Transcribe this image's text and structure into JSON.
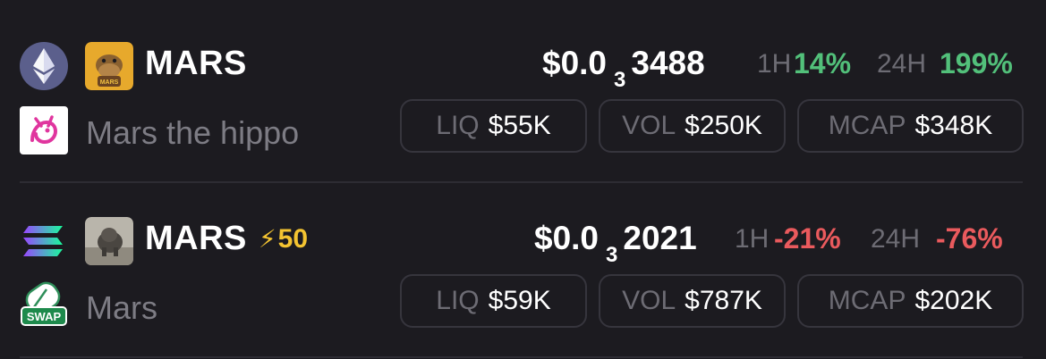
{
  "rows": [
    {
      "chain_icon": "ethereum-icon",
      "dex_icon": "uniswap-icon",
      "token_icon": "hippo-cartoon-icon",
      "symbol": "MARS",
      "boost": "",
      "name": "Mars the hippo",
      "price_prefix": "$0.0",
      "price_zeros": "3",
      "price_digits": "3488",
      "h1_label": "1H",
      "h1_value": "14%",
      "h24_label": "24H",
      "h24_value": "199%",
      "liq_label": "LIQ",
      "liq_value": "$55K",
      "vol_label": "VOL",
      "vol_value": "$250K",
      "mcap_label": "MCAP",
      "mcap_value": "$348K",
      "colors": {
        "change": "#52c07a"
      }
    },
    {
      "chain_icon": "solana-icon",
      "dex_icon": "swap-pill-icon",
      "token_icon": "hippo-photo-icon",
      "symbol": "MARS",
      "boost": "50",
      "name": "Mars",
      "price_prefix": "$0.0",
      "price_zeros": "3",
      "price_digits": "2021",
      "h1_label": "1H",
      "h1_value": "-21%",
      "h24_label": "24H",
      "h24_value": "-76%",
      "liq_label": "LIQ",
      "liq_value": "$59K",
      "vol_label": "VOL",
      "vol_value": "$787K",
      "mcap_label": "MCAP",
      "mcap_value": "$202K",
      "colors": {
        "change": "#ea5a5d"
      }
    }
  ],
  "dex_text": {
    "swap": "SWAP"
  },
  "colors": {
    "background": "#1c1b20",
    "boost": "#f4c431"
  }
}
